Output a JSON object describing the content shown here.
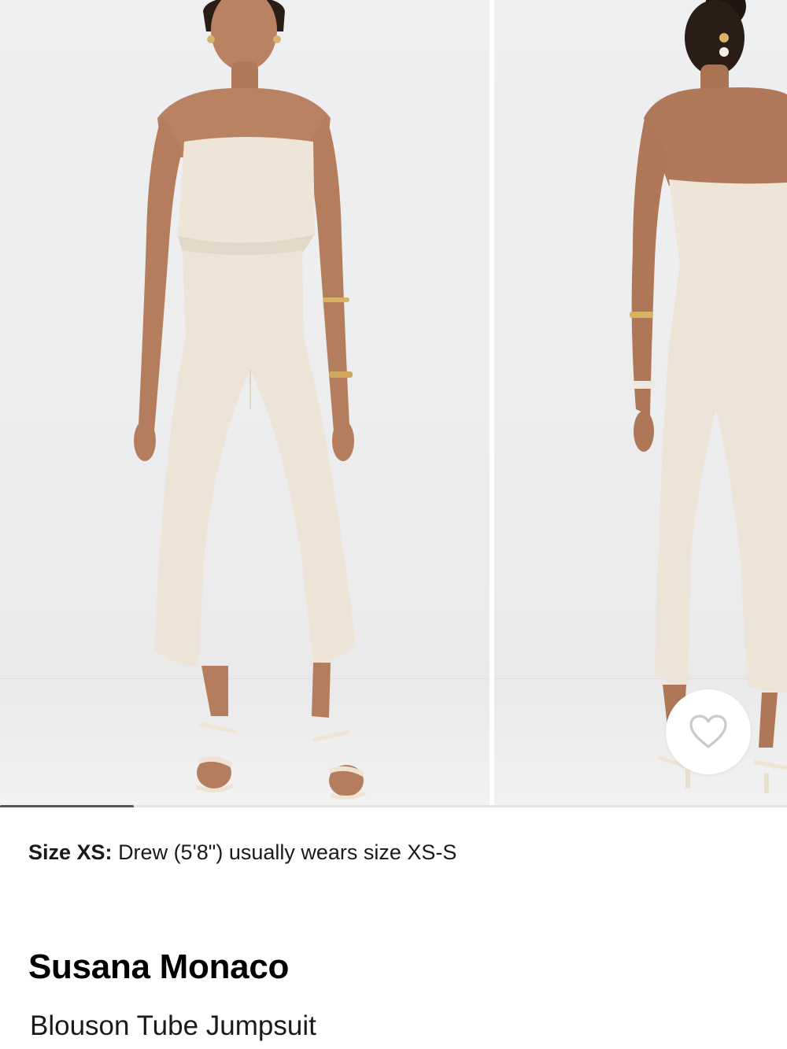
{
  "gallery": {
    "images": [
      {
        "alt": "Model wearing the jumpsuit, front view"
      },
      {
        "alt": "Model wearing the jumpsuit, back view"
      }
    ],
    "wishlist_icon": "heart-outline-icon",
    "scroll_position_fraction": 0.17
  },
  "size_note": {
    "label": "Size XS:",
    "text": "Drew (5'8\") usually wears size XS-S"
  },
  "product": {
    "brand": "Susana Monaco",
    "name": "Blouson Tube Jumpsuit"
  },
  "colors": {
    "garment": "#ede3d6",
    "background": "#ffffff",
    "text": "#111111"
  }
}
